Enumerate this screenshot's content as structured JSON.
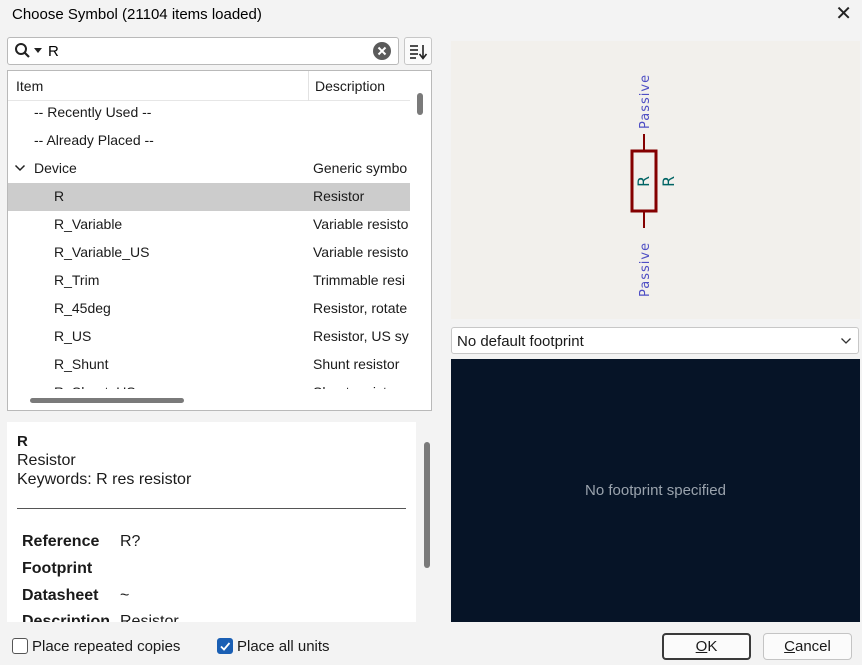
{
  "window": {
    "title": "Choose Symbol (21104 items loaded)"
  },
  "search": {
    "value": "R"
  },
  "tree": {
    "columns": {
      "item": "Item",
      "description": "Description"
    },
    "rows": [
      {
        "name": "-- Recently Used --",
        "desc": ""
      },
      {
        "name": "-- Already Placed --",
        "desc": ""
      },
      {
        "name": "Device",
        "desc": "Generic symbo"
      },
      {
        "name": "R",
        "desc": "Resistor"
      },
      {
        "name": "R_Variable",
        "desc": "Variable resisto"
      },
      {
        "name": "R_Variable_US",
        "desc": "Variable resisto"
      },
      {
        "name": "R_Trim",
        "desc": "Trimmable resi"
      },
      {
        "name": "R_45deg",
        "desc": "Resistor, rotate"
      },
      {
        "name": "R_US",
        "desc": "Resistor, US syi"
      },
      {
        "name": "R_Shunt",
        "desc": "Shunt resistor"
      },
      {
        "name": "R_Shunt_US",
        "desc": "Shunt resistor"
      }
    ]
  },
  "details": {
    "name": "R",
    "description": "Resistor",
    "keywords": "Keywords: R res resistor",
    "properties": [
      {
        "key": "Reference",
        "value": "R?"
      },
      {
        "key": "Footprint",
        "value": ""
      },
      {
        "key": "Datasheet",
        "value": "~"
      },
      {
        "key": "Description",
        "value": "Resistor"
      }
    ]
  },
  "preview": {
    "pin_top_label": "Passive",
    "pin_bottom_label": "Passive",
    "ref_label": "R",
    "value_label": "R"
  },
  "footprint": {
    "selected": "No default footprint",
    "message": "No footprint specified"
  },
  "options": {
    "repeated": {
      "label": "Place repeated copies",
      "checked": false
    },
    "all_units": {
      "label": "Place all units",
      "checked": true
    }
  },
  "buttons": {
    "ok_mnemonic": "O",
    "ok_rest": "K",
    "cancel_mnemonic": "C",
    "cancel_rest": "ancel"
  },
  "colors": {
    "symbol_body": "#840000",
    "pin_text": "#4f4fc4",
    "ref_text": "#006464",
    "footprint_bg": "#061427",
    "accent": "#1a5fb4"
  },
  "icons": [
    "search-icon",
    "chevron-down-icon",
    "clear-icon",
    "sort-icon",
    "close-icon",
    "expand-chevron-icon",
    "check-icon"
  ]
}
